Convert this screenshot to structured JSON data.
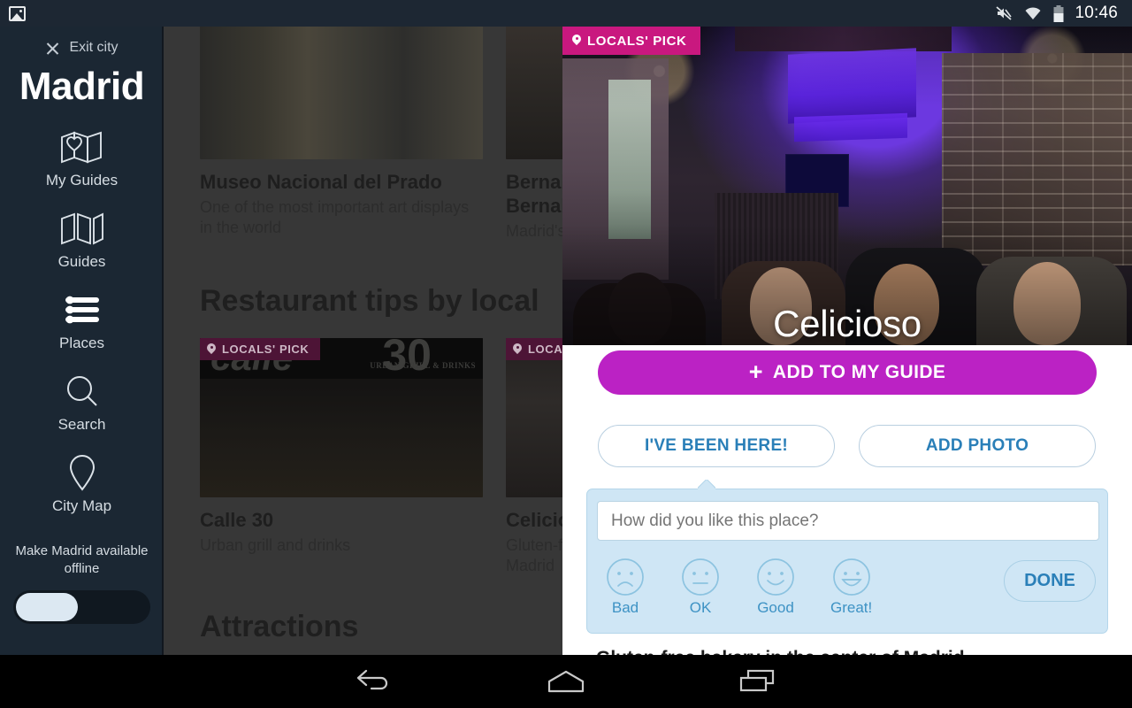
{
  "status_bar": {
    "gallery_icon": "gallery-icon",
    "mute_icon": "mute-icon",
    "wifi_icon": "wifi-icon",
    "battery_icon": "battery-icon",
    "time": "10:46"
  },
  "sidebar": {
    "exit_label": "Exit city",
    "close_icon": "close-icon",
    "city": "Madrid",
    "items": [
      {
        "label": "My Guides",
        "icon": "map-heart-icon"
      },
      {
        "label": "Guides",
        "icon": "folded-map-icon"
      },
      {
        "label": "Places",
        "icon": "list-icon"
      },
      {
        "label": "Search",
        "icon": "search-icon"
      },
      {
        "label": "City Map",
        "icon": "map-pin-icon"
      }
    ],
    "offline_label": "Make Madrid available offline",
    "offline_toggle_state": "off"
  },
  "content": {
    "row1": [
      {
        "title": "Museo Nacional del Prado",
        "subtitle": "One of the most important art displays in the world",
        "badge": null
      },
      {
        "title": "Bernabéu (Estadio Santiago Bernabéu)",
        "subtitle": "Madrid's arena",
        "badge": null
      }
    ],
    "section_heading": "Restaurant tips by local",
    "row2": [
      {
        "title": "Calle 30",
        "subtitle": "Urban grill and drinks",
        "badge": "LOCALS' PICK",
        "sign_word": "calle",
        "sign_number": "30",
        "sign_tag": "URBAN GRILL & DRINKS"
      },
      {
        "title": "Celicioso",
        "subtitle": "Gluten-free bakery in the center of Madrid",
        "badge": "LOCALS' PICK"
      }
    ],
    "next_heading": "Attractions"
  },
  "panel": {
    "badge": "LOCALS' PICK",
    "badge_icon": "map-pin-icon",
    "badge_color": "#c9187f",
    "title": "Celicioso",
    "add_button": "ADD TO MY GUIDE",
    "add_button_icon": "plus-icon",
    "add_button_color": "#bb22c4",
    "been_here_button": "I'VE BEEN HERE!",
    "add_photo_button": "ADD PHOTO",
    "accent_color": "#2a7fb8",
    "review": {
      "placeholder": "How did you like this place?",
      "value": "",
      "ratings": [
        {
          "label": "Bad",
          "icon": "sad-face-icon"
        },
        {
          "label": "OK",
          "icon": "neutral-face-icon"
        },
        {
          "label": "Good",
          "icon": "smile-face-icon"
        },
        {
          "label": "Great!",
          "icon": "grin-face-icon"
        }
      ],
      "done_button": "DONE"
    },
    "description": "Gluten-free bakery in the center of Madrid"
  },
  "navbar": {
    "back_icon": "back-arrow-icon",
    "home_icon": "home-icon",
    "recents_icon": "recent-apps-icon"
  }
}
